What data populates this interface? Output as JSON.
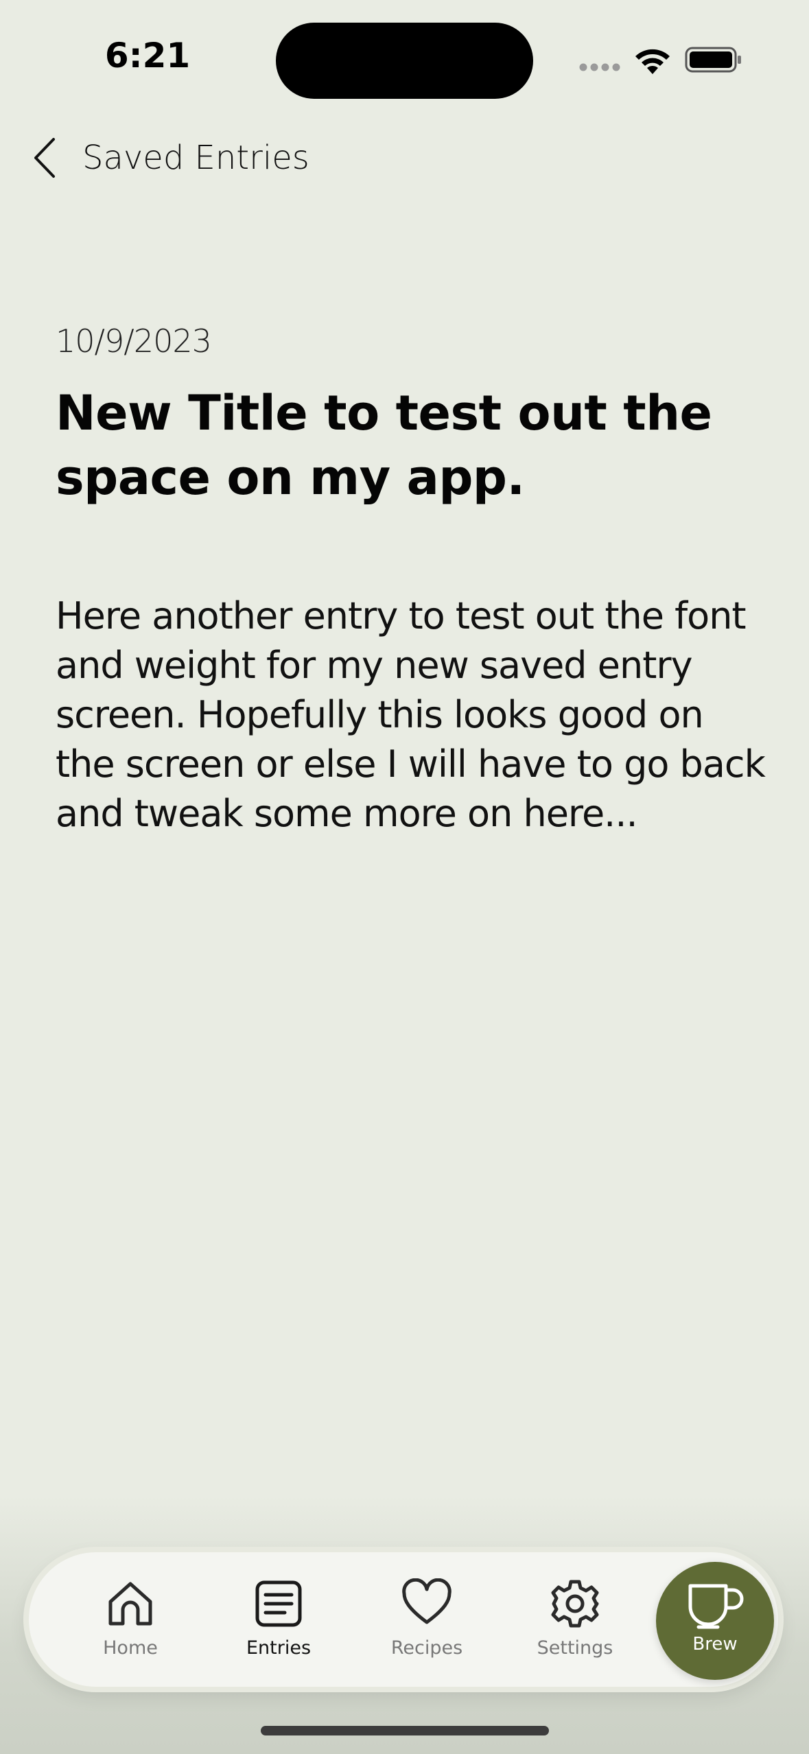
{
  "status_bar": {
    "time": "6:21"
  },
  "nav": {
    "back_label": "Saved Entries"
  },
  "entry": {
    "date": "10/9/2023",
    "title": "New Title to test out the space on my app.",
    "body": "Here another entry to test out the font and weight for my new saved entry screen. Hopefully this looks good on the screen or else I will have to go back and tweak some more on here..."
  },
  "tab_bar": {
    "tabs": [
      {
        "label": "Home",
        "icon": "house-icon",
        "active": false
      },
      {
        "label": "Entries",
        "icon": "list-icon",
        "active": true
      },
      {
        "label": "Recipes",
        "icon": "heart-icon",
        "active": false
      },
      {
        "label": "Settings",
        "icon": "gear-icon",
        "active": false
      }
    ],
    "brew_label": "Brew",
    "brew_icon": "cup-icon"
  },
  "colors": {
    "background": "#E9ECE3",
    "accent": "#5F6B35",
    "tab_bar": "#F4F5F1"
  }
}
